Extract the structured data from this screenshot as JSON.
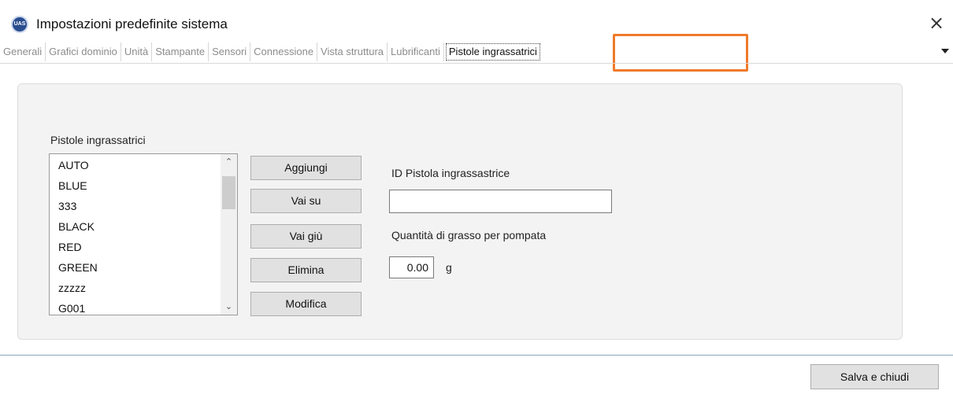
{
  "window": {
    "title": "Impostazioni predefinite sistema",
    "logo_text": "UAS",
    "close_glyph": "×"
  },
  "tabs": [
    {
      "label": "Generali",
      "active": false
    },
    {
      "label": "Grafici dominio",
      "active": false
    },
    {
      "label": "Unità",
      "active": false
    },
    {
      "label": "Stampante",
      "active": false
    },
    {
      "label": "Sensori",
      "active": false
    },
    {
      "label": "Connessione",
      "active": false
    },
    {
      "label": "Vista struttura",
      "active": false
    },
    {
      "label": "Lubrificanti",
      "active": false
    },
    {
      "label": "Pistole ingrassatrici",
      "active": true
    }
  ],
  "grease_guns": {
    "list_label": "Pistole ingrassatrici",
    "items": [
      "AUTO",
      "BLUE",
      "333",
      "BLACK",
      "RED",
      "GREEN",
      "zzzzz",
      "G001"
    ],
    "buttons": {
      "add": "Aggiungi",
      "move_up": "Vai su",
      "move_down": "Vai giù",
      "delete": "Elimina",
      "edit": "Modifica"
    },
    "id_label": "ID Pistola ingrassastrice",
    "id_value": "",
    "qty_label": "Quantità di grasso per pompata",
    "qty_value": "0.00",
    "qty_unit": "g"
  },
  "footer": {
    "save_label": "Salva e chiudi"
  },
  "colors": {
    "highlight": "#ef7a2a",
    "logo": "#2a4d8f"
  },
  "icons": {
    "scroll_up": "chevron-up-icon",
    "scroll_down": "chevron-down-icon",
    "close": "close-icon"
  }
}
